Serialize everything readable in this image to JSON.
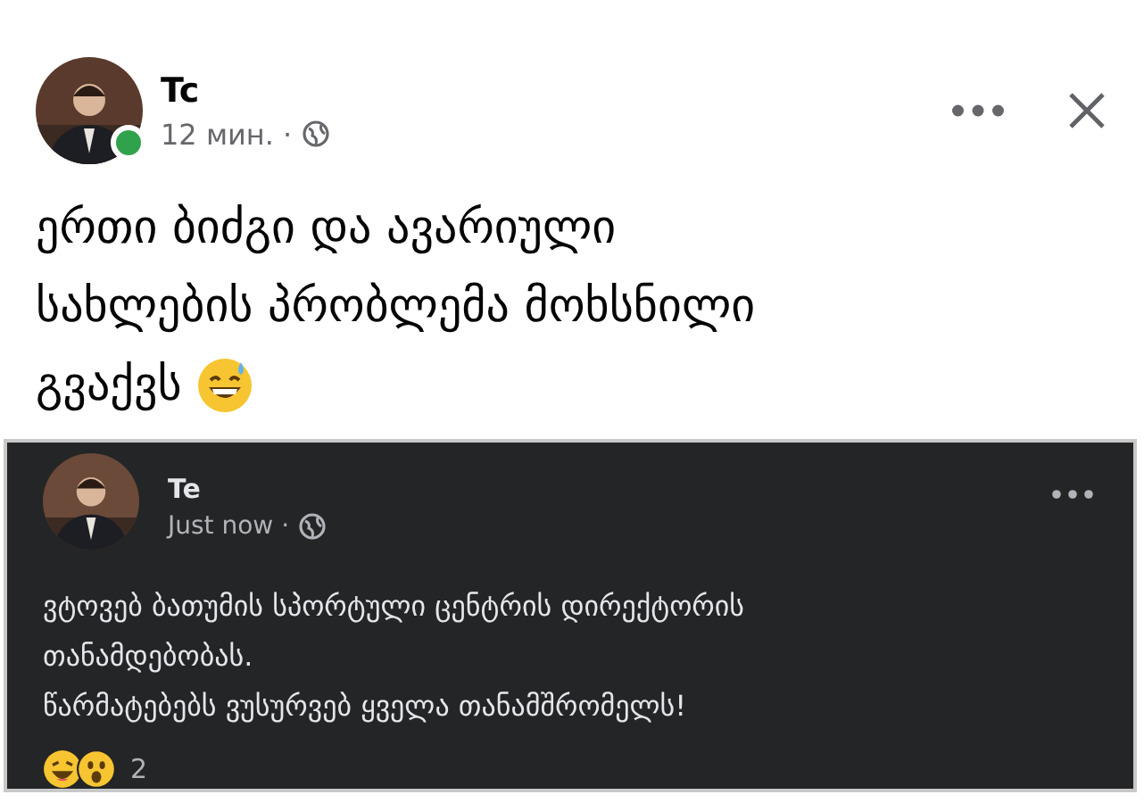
{
  "post": {
    "author": "Tc",
    "online": true,
    "time": "12 мин. ·",
    "lines": [
      "ერთი ბიძგი და ავარიული",
      "სახლების პრობლემა მოხსნილი",
      "გვაქვს"
    ]
  },
  "shared_post": {
    "author": "Te",
    "time": "Just now ·",
    "lines": [
      "ვტოვებ ბათუმის სპორტული ცენტრის დირექტორის",
      "თანამდებობას.",
      "წარმატებებს ვუსურვებ ყველა თანამშრომელს!"
    ],
    "reaction_count": "2"
  }
}
